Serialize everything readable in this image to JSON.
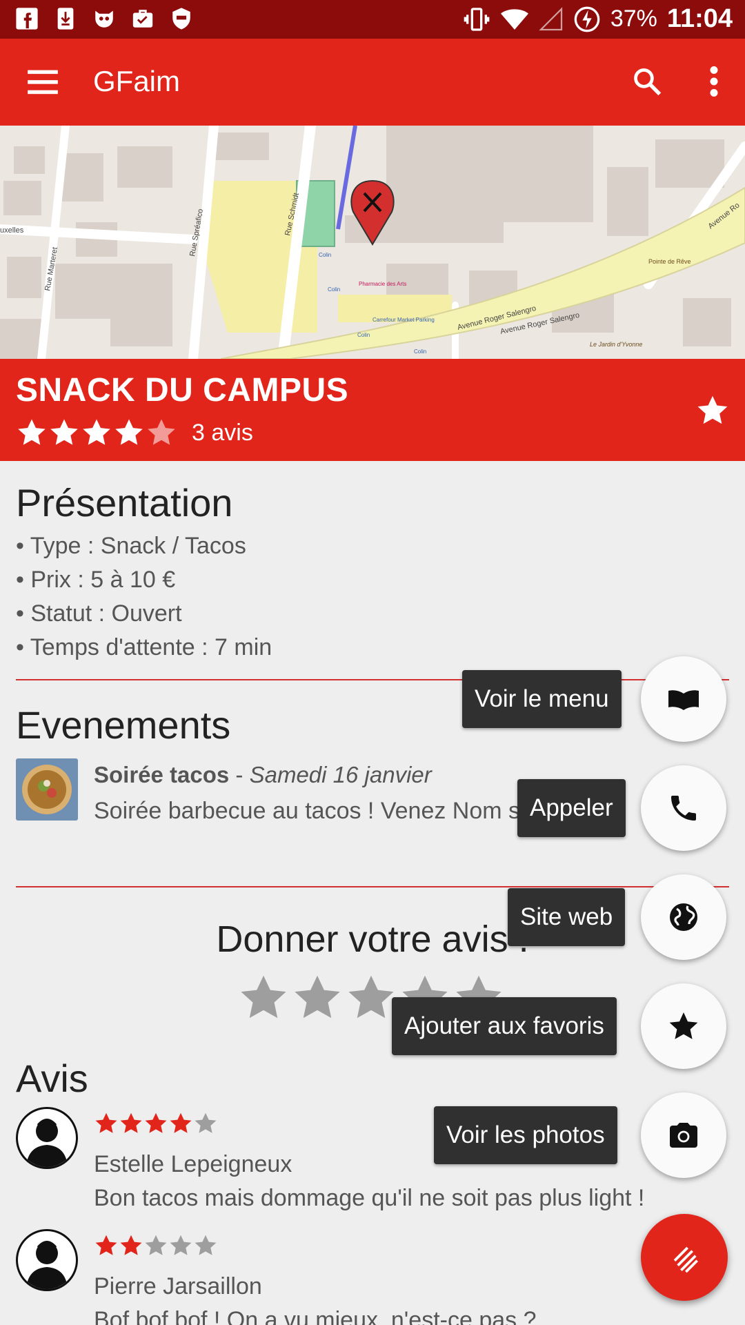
{
  "statusbar": {
    "battery": "37%",
    "time": "11:04",
    "icons": [
      "facebook-icon",
      "download-icon",
      "bot-icon",
      "work-icon",
      "shield-icon",
      "vibrate-icon",
      "wifi-icon",
      "signal-icon",
      "battery-charging-icon"
    ]
  },
  "appbar": {
    "title": "GFaim",
    "icons": [
      "menu-icon",
      "search-icon",
      "more-vert-icon"
    ]
  },
  "map": {
    "labels": [
      "Rue Schmidt",
      "Rue Spréafico",
      "Rue Marteret",
      "Avenue Roger Salengro",
      "Avenue Roger Salengro",
      "Pharmacie des Arts",
      "Carrefour Market Parking",
      "Pointe de Rêve",
      "Le Jardin d'Yvonne",
      "Colin",
      "Colin",
      "Colin",
      "Colin",
      "uxelles",
      "Avenue Ro"
    ]
  },
  "restaurant": {
    "name": "SNACK DU CAMPUS",
    "rating": 4,
    "max_rating": 5,
    "reviews_count": "3 avis"
  },
  "presentation": {
    "title": "Présentation",
    "items": [
      "• Type : Snack / Tacos",
      "• Prix : 5 à 10 €",
      "• Statut : Ouvert",
      "• Temps d'attente : 7 min"
    ]
  },
  "events": {
    "title": "Evenements",
    "items": [
      {
        "name": "Soirée tacos",
        "separator": " - ",
        "date": "Samedi 16 janvier",
        "description": "Soirée barbecue au tacos ! Venez Nom          s canards !"
      }
    ]
  },
  "rate": {
    "title": "Donner votre avis :",
    "stars": 5
  },
  "reviews": {
    "title": "Avis",
    "items": [
      {
        "rating": 4,
        "author": "Estelle Lepeigneux",
        "text": "Bon tacos mais dommage qu'il ne soit pas plus light !"
      },
      {
        "rating": 2,
        "author": "Pierre Jarsaillon",
        "text": "Bof bof bof ! On a vu mieux, n'est-ce pas ?"
      }
    ]
  },
  "fab_menu": {
    "items": [
      {
        "label": "Voir le menu",
        "icon": "book-icon"
      },
      {
        "label": "Appeler",
        "icon": "phone-icon"
      },
      {
        "label": "Site web",
        "icon": "globe-icon"
      },
      {
        "label": "Ajouter aux favoris",
        "icon": "star-icon"
      },
      {
        "label": "Voir les photos",
        "icon": "camera-icon"
      }
    ],
    "main_icon": "close-stripes-icon"
  },
  "colors": {
    "primary": "#e1251b",
    "status_bar": "#8c0c0c",
    "star_active": "#e1251b",
    "star_inactive": "#9e9e9e"
  }
}
